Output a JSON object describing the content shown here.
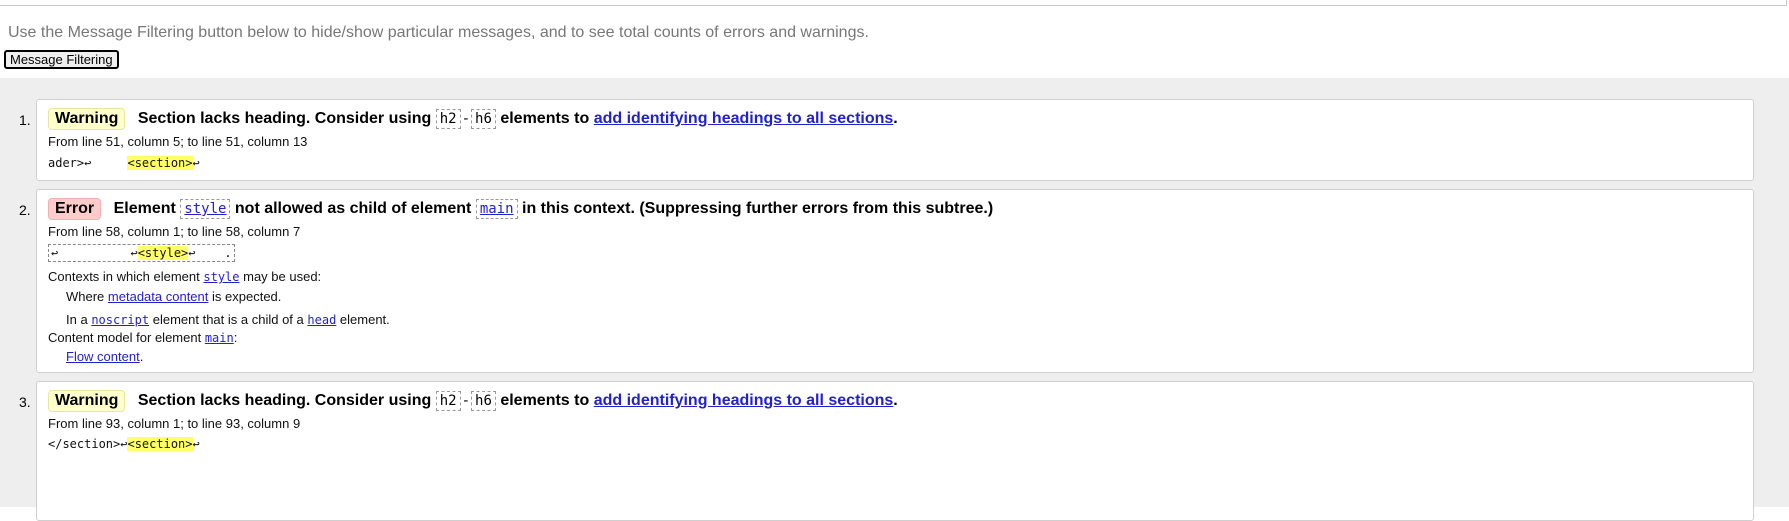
{
  "intro": "Use the Message Filtering button below to hide/show particular messages, and to see total counts of errors and warnings.",
  "filter_button": "Message Filtering",
  "messages": [
    {
      "num": "1.",
      "badge": "Warning",
      "text1": "Section lacks heading. Consider using",
      "code1": "h2",
      "sep": "-",
      "code2": "h6",
      "text2": "elements to",
      "link": "add identifying headings to all sections",
      "end": ".",
      "location": "From line 51, column 5; to line 51, column 13",
      "extract_pre": "ader>↩     ",
      "extract_hl": "<section>",
      "extract_post": "↩"
    },
    {
      "num": "2.",
      "badge": "Error",
      "text1": "Element",
      "code1": "style",
      "text2": "not allowed as child of element",
      "code2": "main",
      "text3": "in this context. (Suppressing further errors from this subtree.)",
      "location": "From line 58, column 1; to line 58, column 7",
      "extract_pre": "↩          ↩",
      "extract_hl": "<style>",
      "extract_post": "↩    .",
      "contexts_label": "Contexts in which element",
      "contexts_code": "style",
      "contexts_end": "may be used:",
      "where_pre": "Where",
      "where_link": "metadata content",
      "where_post": "is expected.",
      "in_pre": "In a",
      "in_code1": "noscript",
      "in_mid": "element that is a child of a",
      "in_code2": "head",
      "in_post": "element.",
      "model_label": "Content model for element",
      "model_code": "main",
      "model_end": ":",
      "flow_link": "Flow content",
      "flow_end": "."
    },
    {
      "num": "3.",
      "badge": "Warning",
      "text1": "Section lacks heading. Consider using",
      "code1": "h2",
      "sep": "-",
      "code2": "h6",
      "text2": "elements to",
      "link": "add identifying headings to all sections",
      "end": ".",
      "location": "From line 93, column 1; to line 93, column 9",
      "extract_pre": "</section>↩",
      "extract_hl": "<section>",
      "extract_post": "↩"
    }
  ]
}
